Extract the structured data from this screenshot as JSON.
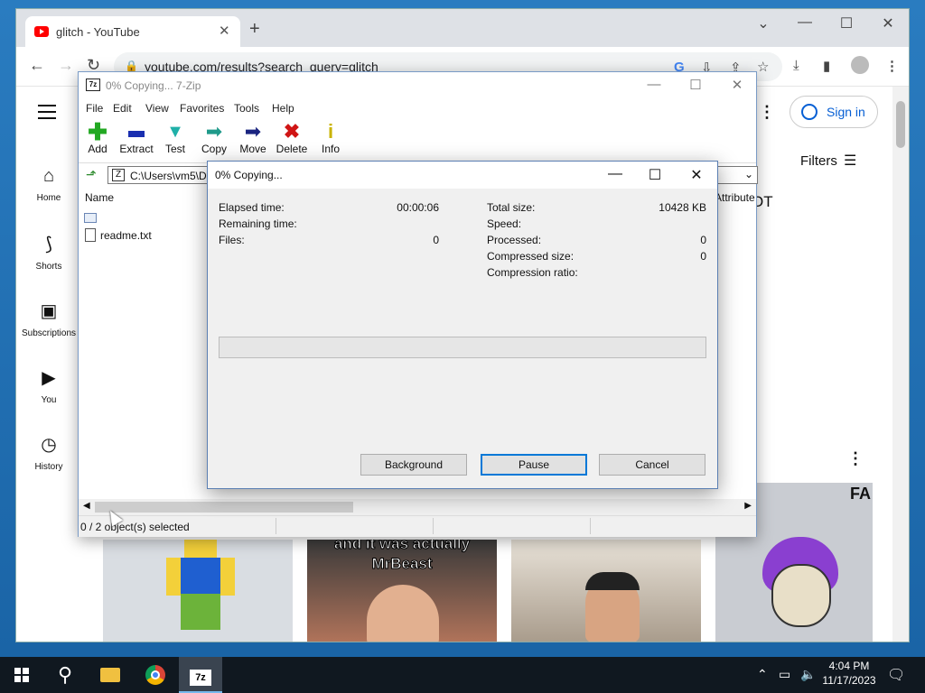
{
  "browser": {
    "tab_title": "glitch - YouTube",
    "url": "youtube.com/results?search_query=glitch",
    "new_tab_symbol": "+",
    "tab_close_symbol": "✕"
  },
  "youtube": {
    "nav": [
      {
        "label": "Home",
        "icon": "home-icon"
      },
      {
        "label": "Shorts",
        "icon": "shorts-icon"
      },
      {
        "label": "Subscriptions",
        "icon": "subscriptions-icon"
      },
      {
        "label": "You",
        "icon": "you-icon"
      },
      {
        "label": "History",
        "icon": "history-icon"
      }
    ],
    "sign_in": "Sign in",
    "filters": "Filters",
    "thumb_caption": "and it was actually MrBeast",
    "thumb_badge": "FA",
    "partial_text": "OT"
  },
  "sevenzip": {
    "title": "0% Copying... 7-Zip",
    "menu": [
      "File",
      "Edit",
      "View",
      "Favorites",
      "Tools",
      "Help"
    ],
    "toolbar": [
      {
        "label": "Add",
        "icon": "add-icon",
        "color": "#22a822"
      },
      {
        "label": "Extract",
        "icon": "extract-icon",
        "color": "#1a2fb0"
      },
      {
        "label": "Test",
        "icon": "test-icon",
        "color": "#1fb0a8"
      },
      {
        "label": "Copy",
        "icon": "copy-icon",
        "color": "#1f9a8a"
      },
      {
        "label": "Move",
        "icon": "move-icon",
        "color": "#1a2480"
      },
      {
        "label": "Delete",
        "icon": "delete-icon",
        "color": "#d01515"
      },
      {
        "label": "Info",
        "icon": "info-icon",
        "color": "#c9b300"
      }
    ],
    "address": "C:\\Users\\vm5\\D",
    "columns": {
      "name": "Name",
      "attributes": "Attribute"
    },
    "files": [
      {
        "name": "",
        "icon": "folder-window-icon"
      },
      {
        "name": "readme.txt",
        "icon": "text-file-icon"
      }
    ],
    "status": "0 / 2 object(s) selected"
  },
  "dialog": {
    "title": "0% Copying...",
    "left": [
      {
        "label": "Elapsed time:",
        "value": "00:00:06"
      },
      {
        "label": "Remaining time:",
        "value": ""
      },
      {
        "label": "Files:",
        "value": "0"
      }
    ],
    "right": [
      {
        "label": "Total size:",
        "value": "10428 KB"
      },
      {
        "label": "Speed:",
        "value": ""
      },
      {
        "label": "Processed:",
        "value": "0"
      },
      {
        "label": "Compressed size:",
        "value": "0"
      },
      {
        "label": "Compression ratio:",
        "value": ""
      }
    ],
    "progress_fraction": 0,
    "buttons": {
      "background": "Background",
      "pause": "Pause",
      "cancel": "Cancel"
    }
  },
  "taskbar": {
    "time": "4:04 PM",
    "date": "11/17/2023",
    "zip_label": "7z"
  }
}
